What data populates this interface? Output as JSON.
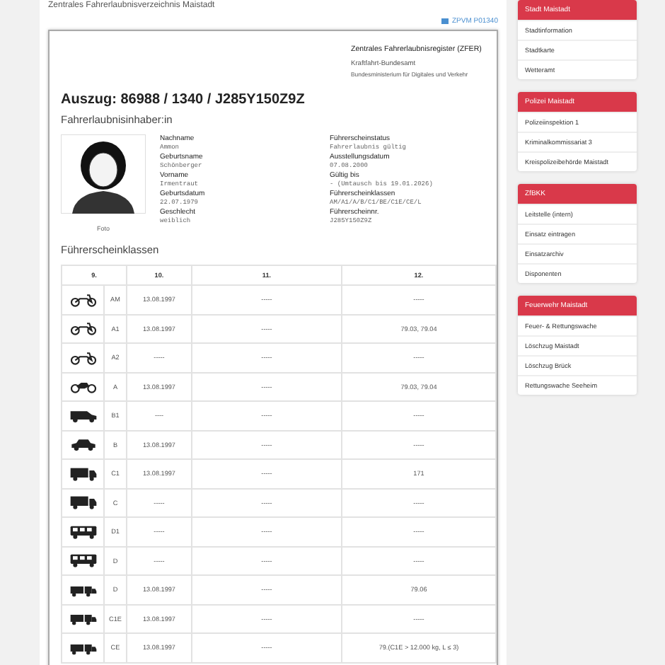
{
  "page_title": "Zentrales Fahrerlaubnisverzeichnis Maistadt",
  "doc_link": "ZPVM P01340",
  "issuer": {
    "register": "Zentrales Fahrerlaubnisregister (ZFER)",
    "authority": "Kraftfahrt-Bundesamt",
    "ministry": "Bundesministerium für Digitales und Verkehr"
  },
  "extract_title": "Auszug: 86988 / 1340 / J285Y150Z9Z",
  "holder_heading": "Fahrerlaubnisinhaber:in",
  "photo_caption": "Foto",
  "fields_left": [
    {
      "label": "Nachname",
      "value": "Ammon"
    },
    {
      "label": "Geburtsname",
      "value": "Schönberger"
    },
    {
      "label": "Vorname",
      "value": "Irmentraut"
    },
    {
      "label": "Geburtsdatum",
      "value": "22.07.1979"
    },
    {
      "label": "Geschlecht",
      "value": "weiblich"
    }
  ],
  "fields_right": [
    {
      "label": "Führerscheinstatus",
      "value": "Fahrerlaubnis gültig"
    },
    {
      "label": "Ausstellungsdatum",
      "value": "07.08.2000"
    },
    {
      "label": "Gültig bis",
      "value": "- (Umtausch bis 19.01.2026)"
    },
    {
      "label": "Führerscheinklassen",
      "value": "AM/A1/A/B/C1/BE/C1E/CE/L"
    },
    {
      "label": "Führerscheinnr.",
      "value": "J285Y150Z9Z"
    }
  ],
  "classes_heading": "Führerscheinklassen",
  "table": {
    "columns": [
      "9.",
      "10.",
      "11.",
      "12."
    ],
    "rows": [
      {
        "kind": "moped",
        "class": "AM",
        "c10": "13.08.1997",
        "c11": "-----",
        "c12": "-----"
      },
      {
        "kind": "moped",
        "class": "A1",
        "c10": "13.08.1997",
        "c11": "-----",
        "c12": "79.03, 79.04"
      },
      {
        "kind": "moped",
        "class": "A2",
        "c10": "-----",
        "c11": "-----",
        "c12": "-----"
      },
      {
        "kind": "motorcycle",
        "class": "A",
        "c10": "13.08.1997",
        "c11": "-----",
        "c12": "79.03, 79.04"
      },
      {
        "kind": "van",
        "class": "B1",
        "c10": "----",
        "c11": "-----",
        "c12": "-----"
      },
      {
        "kind": "car",
        "class": "B",
        "c10": "13.08.1997",
        "c11": "-----",
        "c12": "-----"
      },
      {
        "kind": "truck",
        "class": "C1",
        "c10": "13.08.1997",
        "c11": "-----",
        "c12": "171"
      },
      {
        "kind": "truck",
        "class": "C",
        "c10": "-----",
        "c11": "-----",
        "c12": "-----"
      },
      {
        "kind": "bus",
        "class": "D1",
        "c10": "-----",
        "c11": "-----",
        "c12": "-----"
      },
      {
        "kind": "bus",
        "class": "D",
        "c10": "-----",
        "c11": "-----",
        "c12": "-----"
      },
      {
        "kind": "trailer",
        "class": "D",
        "c10": "13.08.1997",
        "c11": "-----",
        "c12": "79.06"
      },
      {
        "kind": "trailer",
        "class": "C1E",
        "c10": "13.08.1997",
        "c11": "-----",
        "c12": "-----"
      },
      {
        "kind": "trailer",
        "class": "CE",
        "c10": "13.08.1997",
        "c11": "-----",
        "c12": "79.(C1E > 12.000 kg, L ≤ 3)"
      }
    ]
  },
  "sidebar": [
    {
      "title": "Stadt Maistadt",
      "items": [
        "Stadtinformation",
        "Stadtkarte",
        "Wetteramt"
      ]
    },
    {
      "title": "Polizei Maistadt",
      "items": [
        "Polizeiinspektion 1",
        "Kriminalkommissariat 3",
        "Kreispolizeibehörde Maistadt"
      ]
    },
    {
      "title": "ZfBKK",
      "items": [
        "Leitstelle (intern)",
        "Einsatz eintragen",
        "Einsatzarchiv",
        "Disponenten"
      ]
    },
    {
      "title": "Feuerwehr Maistadt",
      "items": [
        "Feuer- & Rettungswache",
        "Löschzug Maistadt",
        "Löschzug Brück",
        "Rettungswache Seeheim"
      ]
    }
  ]
}
